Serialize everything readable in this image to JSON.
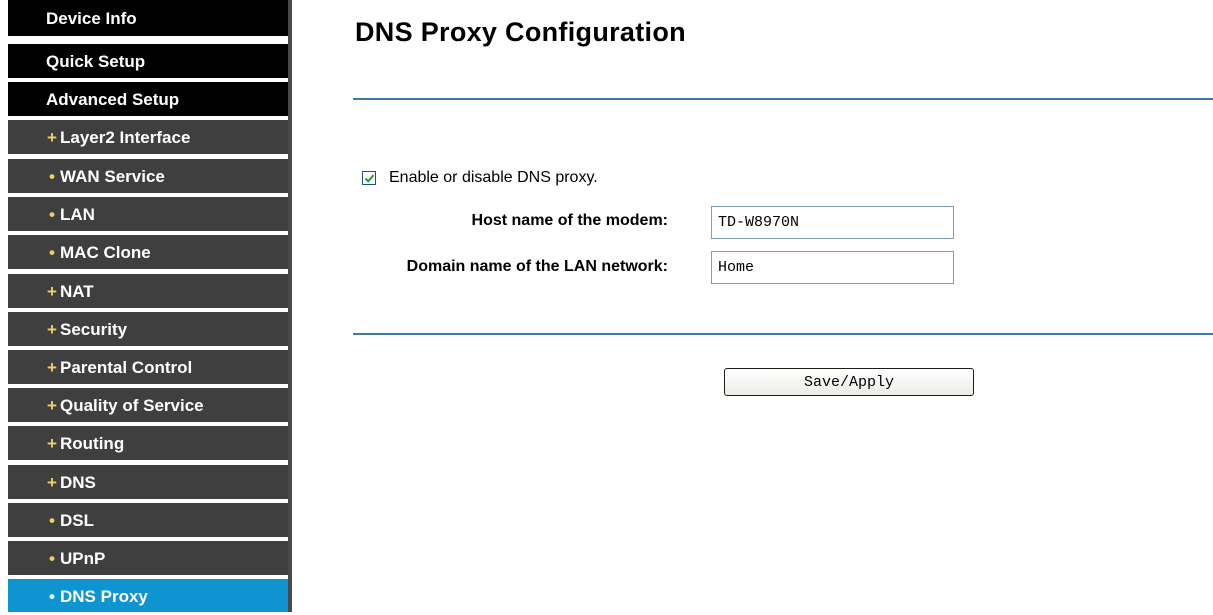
{
  "sidebar": {
    "items": [
      {
        "label": "Device Info"
      },
      {
        "label": "Quick Setup"
      },
      {
        "label": "Advanced Setup"
      },
      {
        "label": "Layer2 Interface",
        "bullet": "+"
      },
      {
        "label": "WAN Service",
        "bullet": "•"
      },
      {
        "label": "LAN",
        "bullet": "•"
      },
      {
        "label": "MAC Clone",
        "bullet": "•"
      },
      {
        "label": "NAT",
        "bullet": "+"
      },
      {
        "label": "Security",
        "bullet": "+"
      },
      {
        "label": "Parental Control",
        "bullet": "+"
      },
      {
        "label": "Quality of Service",
        "bullet": "+"
      },
      {
        "label": "Routing",
        "bullet": "+"
      },
      {
        "label": "DNS",
        "bullet": "+"
      },
      {
        "label": "DSL",
        "bullet": "•"
      },
      {
        "label": "UPnP",
        "bullet": "•"
      },
      {
        "label": "DNS Proxy",
        "bullet": "•",
        "active": true
      }
    ],
    "colors": {
      "top": "#000000",
      "sub": "#3f3f3f",
      "active": "#0f94d2",
      "bullet": "#f0d060"
    }
  },
  "page": {
    "title": "DNS Proxy Configuration",
    "enable": {
      "label": "Enable or disable DNS proxy.",
      "checked": true
    },
    "host": {
      "label": "Host name of the modem:",
      "value": "TD-W8970N"
    },
    "domain": {
      "label": "Domain name of the LAN network:",
      "value": "Home"
    },
    "save_label": "Save/Apply",
    "colors": {
      "rule": "#3a7ca8"
    }
  }
}
